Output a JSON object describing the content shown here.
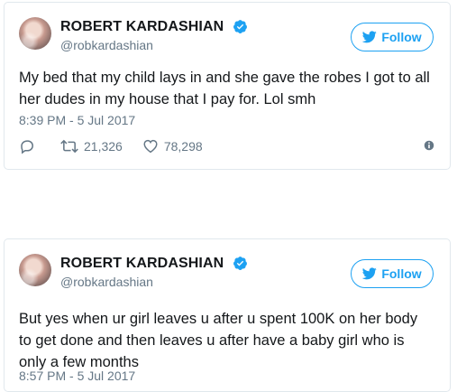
{
  "tweets": [
    {
      "name": "ROBERT KARDASHIAN",
      "handle": "@robkardashian",
      "follow_label": "Follow",
      "text": "My bed that my child lays in and she gave the robes I got to all her dudes in my house that I pay for. Lol smh",
      "timestamp": "8:39 PM - 5 Jul 2017",
      "retweets": "21,326",
      "likes": "78,298"
    },
    {
      "name": "ROBERT KARDASHIAN",
      "handle": "@robkardashian",
      "follow_label": "Follow",
      "text": "But yes when ur girl leaves u after u spent 100K on her body to get done and then leaves u after have a baby girl who is only a few months",
      "timestamp": "8:57 PM - 5 Jul 2017"
    }
  ],
  "icons": {
    "verified": "verified-badge-icon",
    "follow": "twitter-bird-icon",
    "reply": "reply-icon",
    "retweet": "retweet-icon",
    "like": "heart-icon",
    "info": "info-icon"
  },
  "colors": {
    "accent": "#1da1f2",
    "muted": "#657786",
    "text": "#14171a",
    "border": "#e1e8ed"
  }
}
